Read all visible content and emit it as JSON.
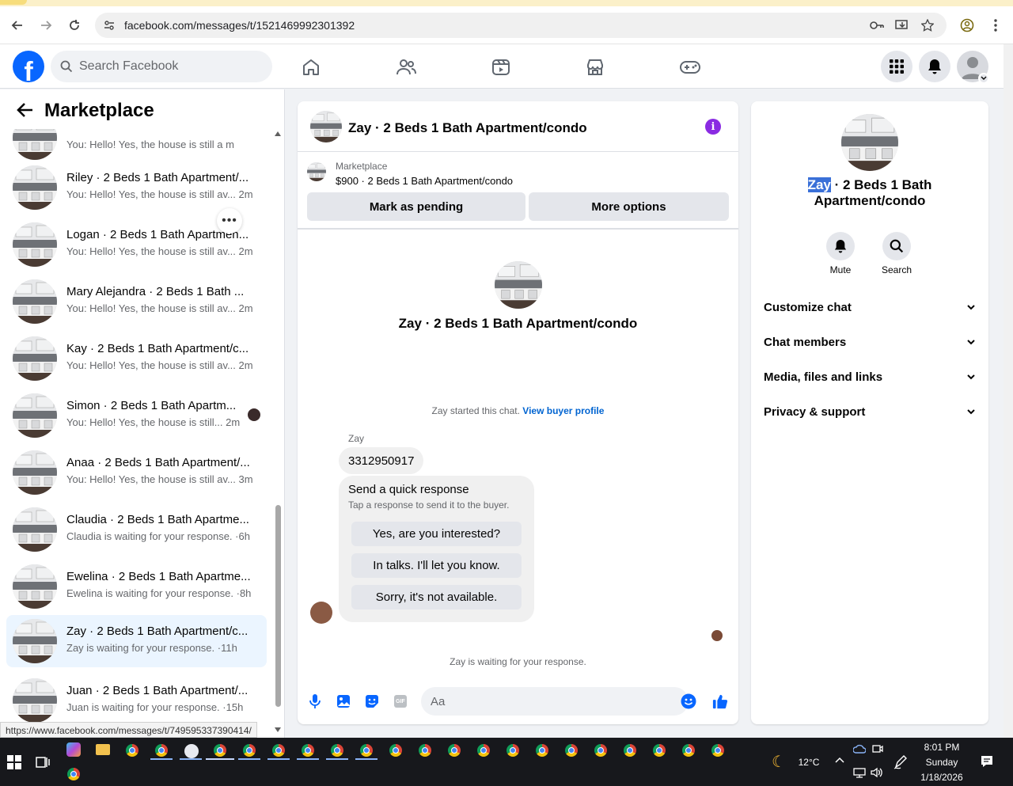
{
  "browser": {
    "url": "facebook.com/messages/t/1521469992301392",
    "status_url": "https://www.facebook.com/messages/t/749595337390414/"
  },
  "header": {
    "logo": "f",
    "search_placeholder": "Search Facebook"
  },
  "left_panel": {
    "title": "Marketplace",
    "more_label": "•••",
    "conversations": [
      {
        "name": "",
        "preview": "You: Hello! Yes, the house is still a",
        "time": "m"
      },
      {
        "name": "Riley · 2 Beds 1 Bath Apartment/...",
        "preview": "You: Hello! Yes, the house is still av...",
        "time": "2m"
      },
      {
        "name": "Logan · 2 Beds 1 Bath Apartmen...",
        "preview": "You: Hello! Yes, the house is still av...",
        "time": "2m"
      },
      {
        "name": "Mary Alejandra · 2 Beds 1 Bath ...",
        "preview": "You: Hello! Yes, the house is still av...",
        "time": "2m"
      },
      {
        "name": "Kay · 2 Beds 1 Bath Apartment/c...",
        "preview": "You: Hello! Yes, the house is still av...",
        "time": "2m"
      },
      {
        "name": "Simon · 2 Beds 1 Bath Apartm...",
        "preview": "You: Hello! Yes, the house is still...",
        "time": "2m"
      },
      {
        "name": "Anaa · 2 Beds 1 Bath Apartment/...",
        "preview": "You: Hello! Yes, the house is still av...",
        "time": "3m"
      },
      {
        "name": "Claudia · 2 Beds 1 Bath Apartme...",
        "preview": "Claudia is waiting for your response. ·",
        "time": "6h"
      },
      {
        "name": "Ewelina · 2 Beds 1 Bath Apartme...",
        "preview": "Ewelina is waiting for your response. ·",
        "time": "8h"
      },
      {
        "name": "Zay · 2 Beds 1 Bath Apartment/c...",
        "preview": "Zay is waiting for your response. ·",
        "time": "11h"
      },
      {
        "name": "Juan · 2 Beds 1 Bath Apartment/...",
        "preview": "Juan is waiting for your response. ·",
        "time": "15h"
      }
    ]
  },
  "chat": {
    "title": "Zay · 2 Beds 1 Bath Apartment/condo",
    "info_label": "i",
    "listing_label": "Marketplace",
    "listing_price": "$900 · 2 Beds 1 Bath Apartment/condo",
    "mark_pending": "Mark as pending",
    "more_options": "More options",
    "center_name": "Zay · 2 Beds 1 Bath Apartment/condo",
    "started_text": "Zay started this chat.",
    "buyer_profile_link": "View buyer profile",
    "sender": "Zay",
    "message": "3312950917",
    "quick_title": "Send a quick response",
    "quick_subtitle": "Tap a response to send it to the buyer.",
    "quick_options": [
      "Yes, are you interested?",
      "In talks. I'll let you know.",
      "Sorry, it's not available."
    ],
    "waiting_text": "Zay is waiting for your response.",
    "composer_placeholder": "Aa",
    "gif_label": "GIF"
  },
  "right_panel": {
    "title_highlight": "Zay",
    "title_rest": " · 2 Beds 1 Bath Apartment/condo",
    "mute_label": "Mute",
    "search_label": "Search",
    "sections": [
      "Customize chat",
      "Chat members",
      "Media, files and links",
      "Privacy & support"
    ]
  },
  "taskbar": {
    "weather": "12°C",
    "time": "8:01 PM",
    "day": "Sunday",
    "date": "1/18/2026"
  },
  "colors": {
    "fb_blue": "#0866ff",
    "active_row": "#ebf5ff",
    "link": "#0064d1",
    "info_purple": "#8a2be2",
    "taskbar": "#17181c"
  }
}
